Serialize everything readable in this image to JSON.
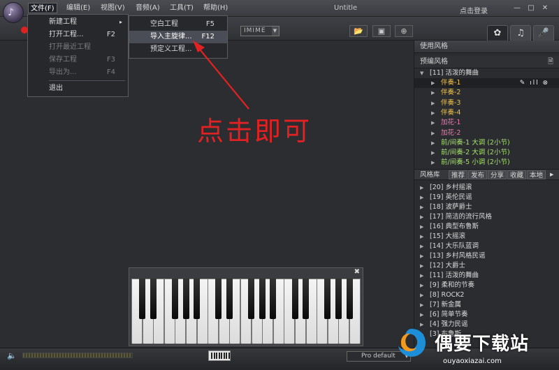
{
  "titlebar": {
    "menus": [
      "文件(F)",
      "编辑(E)",
      "视图(V)",
      "音频(A)",
      "工具(T)",
      "帮助(H)"
    ],
    "app_title": "Untitle",
    "login": "点击登录",
    "min": "—",
    "max": "□",
    "close": "✕"
  },
  "toolbar": {
    "imime": "IMIME",
    "dropdown_arrow": "▼"
  },
  "file_menu": [
    {
      "label": "新建工程",
      "shortcut": "",
      "submenu": "▸"
    },
    {
      "label": "打开工程...",
      "shortcut": "F2"
    },
    {
      "label": "打开最近工程",
      "shortcut": ""
    },
    {
      "label": "保存工程",
      "shortcut": "F3"
    },
    {
      "label": "导出为...",
      "shortcut": "F4"
    },
    {
      "label": "退出",
      "shortcut": ""
    }
  ],
  "new_submenu": [
    {
      "label": "空白工程",
      "shortcut": "F5"
    },
    {
      "label": "导入主旋律...",
      "shortcut": "F12"
    },
    {
      "label": "预定义工程...",
      "shortcut": ""
    }
  ],
  "annotation": "点击即可",
  "right_panel": {
    "header_style": "使用风格",
    "header_preset": "预编风格",
    "preset_root": "[11] 活泼的舞曲",
    "preset_items": [
      {
        "label": "伴奏-1",
        "color": "#f0c24a"
      },
      {
        "label": "伴奏-2",
        "color": "#f0c24a"
      },
      {
        "label": "伴奏-3",
        "color": "#f0c24a"
      },
      {
        "label": "伴奏-4",
        "color": "#f0c24a"
      },
      {
        "label": "加花-1",
        "color": "#f07ab0"
      },
      {
        "label": "加花-2",
        "color": "#f07ab0"
      },
      {
        "label": "前/间奏-1 大调 (2小节)",
        "color": "#a6e06a"
      },
      {
        "label": "前/间奏-2 大调 (2小节)",
        "color": "#a6e06a"
      },
      {
        "label": "前/间奏-5 小调 (2小节)",
        "color": "#a6e06a"
      }
    ],
    "lib_tabs": [
      "风格库",
      "推荐",
      "发布",
      "分享",
      "收藏",
      "本地"
    ],
    "library": [
      "[20] 乡村摇滚",
      "[19] 英伦民谣",
      "[18] 波萨爵士",
      "[17] 简洁的流行风格",
      "[16] 典型布鲁斯",
      "[15] 大摇滚",
      "[14] 大乐队蓝调",
      "[13] 乡村风格民谣",
      "[12] 大爵士",
      "[11] 活泼的舞曲",
      "[9] 柔和的节奏",
      "[8] ROCK2",
      "[7] 新金属",
      "[6] 简单节奏",
      "[4] 强力民谣",
      "[3] 布鲁斯"
    ]
  },
  "statusbar": {
    "profile": "Pro default"
  },
  "watermark": {
    "text": "偶要下载站",
    "url": "ouyaoxiazai.com"
  },
  "colors": {
    "accent_red": "#e22222",
    "preset_root": "#d8d8d8"
  }
}
